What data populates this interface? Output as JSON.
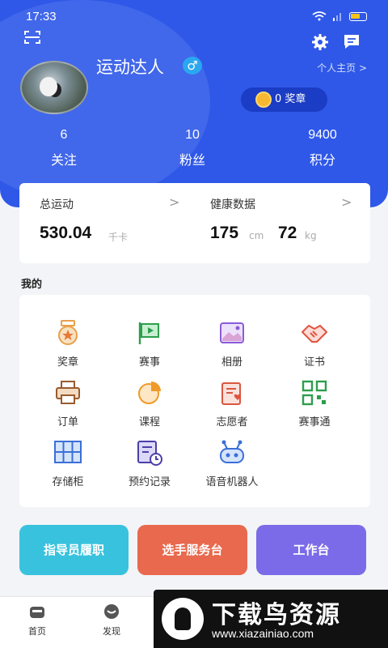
{
  "status_bar": {
    "time": "17:33"
  },
  "profile": {
    "username": "运动达人",
    "gender_symbol": "♂",
    "profile_link": "个人主页 >",
    "badge_count": "0 奖章"
  },
  "stats": [
    {
      "value": "6",
      "label": "关注"
    },
    {
      "value": "10",
      "label": "粉丝"
    },
    {
      "value": "9400",
      "label": "积分"
    }
  ],
  "data_card": {
    "exercise_title": "总运动",
    "exercise_value": "530.04",
    "exercise_unit": "千卡",
    "health_title": "健康数据",
    "height_value": "175",
    "height_unit": "cm",
    "weight_value": "72",
    "weight_unit": "kg",
    "arrow": ">"
  },
  "my_section": {
    "title": "我的",
    "items": [
      {
        "label": "奖章",
        "icon": "medal-icon"
      },
      {
        "label": "赛事",
        "icon": "flag-icon"
      },
      {
        "label": "相册",
        "icon": "album-icon"
      },
      {
        "label": "证书",
        "icon": "handshake-icon"
      },
      {
        "label": "订单",
        "icon": "printer-icon"
      },
      {
        "label": "课程",
        "icon": "pie-chart-icon"
      },
      {
        "label": "志愿者",
        "icon": "clipboard-heart-icon"
      },
      {
        "label": "赛事通",
        "icon": "qrcode-icon"
      },
      {
        "label": "存储柜",
        "icon": "locker-icon"
      },
      {
        "label": "预约记录",
        "icon": "appointment-icon"
      },
      {
        "label": "语音机器人",
        "icon": "robot-icon"
      }
    ]
  },
  "actions": [
    {
      "label": "指导员履职",
      "color": "#39c2dd"
    },
    {
      "label": "选手服务台",
      "color": "#e8694e"
    },
    {
      "label": "工作台",
      "color": "#7b6be8"
    }
  ],
  "tabbar": [
    {
      "label": "首页",
      "icon": "home-icon"
    },
    {
      "label": "发现",
      "icon": "discover-icon"
    }
  ],
  "watermark": {
    "title": "下载鸟资源",
    "url": "www.xiazainiao.com"
  },
  "colors": {
    "primary": "#2f58e8",
    "badge_bg": "#1b3cc4"
  }
}
